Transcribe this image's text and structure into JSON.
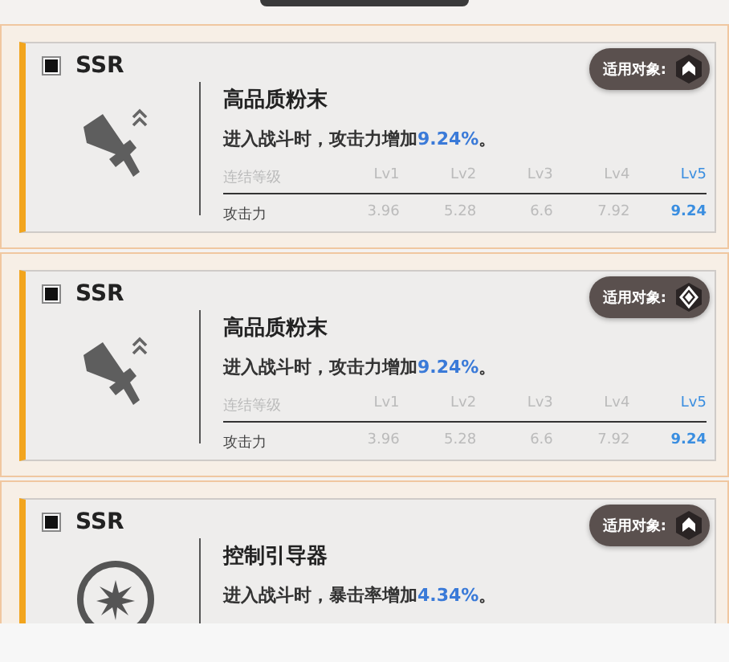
{
  "cards": [
    {
      "rarity": "SSR",
      "kind": "sword",
      "badge": {
        "label": "适用对象:",
        "kind": "shield"
      },
      "title": "高品质粉末",
      "description": {
        "text": "进入战斗时，攻击力增加",
        "highlight": "9.24%",
        "suffix": "。"
      },
      "table": {
        "header": "连结等级",
        "levels": [
          {
            "label": "Lv1",
            "selected": false
          },
          {
            "label": "Lv2",
            "selected": false
          },
          {
            "label": "Lv3",
            "selected": false
          },
          {
            "label": "Lv4",
            "selected": false
          },
          {
            "label": "Lv5",
            "selected": true
          }
        ],
        "row_label": "攻击力",
        "values": [
          "3.96",
          "5.28",
          "6.6",
          "7.92",
          "9.24"
        ]
      }
    },
    {
      "rarity": "SSR",
      "kind": "sword",
      "badge": {
        "label": "适用对象:",
        "kind": "diamond"
      },
      "title": "高品质粉末",
      "description": {
        "text": "进入战斗时，攻击力增加",
        "highlight": "9.24%",
        "suffix": "。"
      },
      "table": {
        "header": "连结等级",
        "levels": [
          {
            "label": "Lv1",
            "selected": false
          },
          {
            "label": "Lv2",
            "selected": false
          },
          {
            "label": "Lv3",
            "selected": false
          },
          {
            "label": "Lv4",
            "selected": false
          },
          {
            "label": "Lv5",
            "selected": true
          }
        ],
        "row_label": "攻击力",
        "values": [
          "3.96",
          "5.28",
          "6.6",
          "7.92",
          "9.24"
        ]
      }
    },
    {
      "rarity": "SSR",
      "kind": "target",
      "badge": {
        "label": "适用对象:",
        "kind": "shield"
      },
      "title": "控制引导器",
      "description": {
        "text": "进入战斗时，暴击率增加",
        "highlight": "4.34%",
        "suffix": "。"
      }
    }
  ]
}
